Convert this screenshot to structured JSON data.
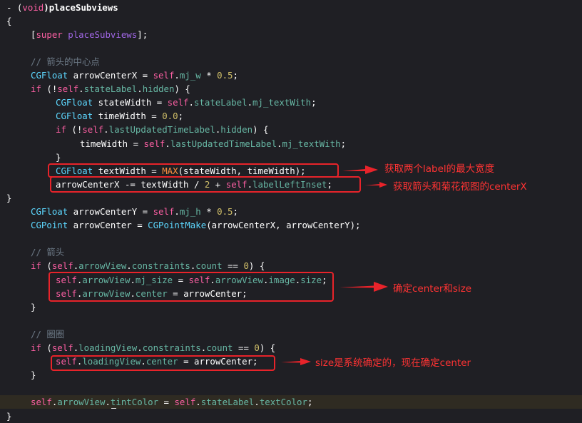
{
  "code_lines": [
    {
      "indent": 0,
      "tokens": [
        {
          "t": "- (",
          "c": "pl"
        },
        {
          "t": "void",
          "c": "kw"
        },
        {
          "t": ")placeSubviews",
          "c": "pl bold"
        }
      ]
    },
    {
      "indent": 0,
      "tokens": [
        {
          "t": "{",
          "c": "pl"
        }
      ]
    },
    {
      "indent": 1,
      "tokens": [
        {
          "t": "[",
          "c": "pl"
        },
        {
          "t": "super",
          "c": "kw"
        },
        {
          "t": " ",
          "c": "pl"
        },
        {
          "t": "placeSubviews",
          "c": "func"
        },
        {
          "t": "];",
          "c": "pl"
        }
      ]
    },
    {
      "indent": 0,
      "tokens": []
    },
    {
      "indent": 1,
      "tokens": [
        {
          "t": "// 箭头的中心点",
          "c": "cmt"
        }
      ]
    },
    {
      "indent": 1,
      "tokens": [
        {
          "t": "CGFloat",
          "c": "cls"
        },
        {
          "t": " arrowCenterX = ",
          "c": "pl"
        },
        {
          "t": "self",
          "c": "kw"
        },
        {
          "t": ".",
          "c": "pl"
        },
        {
          "t": "mj_w",
          "c": "prop"
        },
        {
          "t": " * ",
          "c": "pl"
        },
        {
          "t": "0.5",
          "c": "num"
        },
        {
          "t": ";",
          "c": "pl"
        }
      ]
    },
    {
      "indent": 1,
      "tokens": [
        {
          "t": "if",
          "c": "kw"
        },
        {
          "t": " (!",
          "c": "pl"
        },
        {
          "t": "self",
          "c": "kw"
        },
        {
          "t": ".",
          "c": "pl"
        },
        {
          "t": "stateLabel",
          "c": "prop"
        },
        {
          "t": ".",
          "c": "pl"
        },
        {
          "t": "hidden",
          "c": "prop"
        },
        {
          "t": ") {",
          "c": "pl"
        }
      ]
    },
    {
      "indent": 2,
      "tokens": [
        {
          "t": "CGFloat",
          "c": "cls"
        },
        {
          "t": " stateWidth = ",
          "c": "pl"
        },
        {
          "t": "self",
          "c": "kw"
        },
        {
          "t": ".",
          "c": "pl"
        },
        {
          "t": "stateLabel",
          "c": "prop"
        },
        {
          "t": ".",
          "c": "pl"
        },
        {
          "t": "mj_textWith",
          "c": "prop"
        },
        {
          "t": ";",
          "c": "pl"
        }
      ]
    },
    {
      "indent": 2,
      "tokens": [
        {
          "t": "CGFloat",
          "c": "cls"
        },
        {
          "t": " timeWidth = ",
          "c": "pl"
        },
        {
          "t": "0.0",
          "c": "num"
        },
        {
          "t": ";",
          "c": "pl"
        }
      ]
    },
    {
      "indent": 2,
      "tokens": [
        {
          "t": "if",
          "c": "kw"
        },
        {
          "t": " (!",
          "c": "pl"
        },
        {
          "t": "self",
          "c": "kw"
        },
        {
          "t": ".",
          "c": "pl"
        },
        {
          "t": "lastUpdatedTimeLabel",
          "c": "prop"
        },
        {
          "t": ".",
          "c": "pl"
        },
        {
          "t": "hidden",
          "c": "prop"
        },
        {
          "t": ") {",
          "c": "pl"
        }
      ]
    },
    {
      "indent": 3,
      "tokens": [
        {
          "t": "timeWidth = ",
          "c": "pl"
        },
        {
          "t": "self",
          "c": "kw"
        },
        {
          "t": ".",
          "c": "pl"
        },
        {
          "t": "lastUpdatedTimeLabel",
          "c": "prop"
        },
        {
          "t": ".",
          "c": "pl"
        },
        {
          "t": "mj_textWith",
          "c": "prop"
        },
        {
          "t": ";",
          "c": "pl"
        }
      ]
    },
    {
      "indent": 2,
      "tokens": [
        {
          "t": "}",
          "c": "pl"
        }
      ]
    },
    {
      "indent": 2,
      "tokens": [
        {
          "t": "CGFloat",
          "c": "cls"
        },
        {
          "t": " textWidth = ",
          "c": "pl"
        },
        {
          "t": "MAX",
          "c": "mac"
        },
        {
          "t": "(stateWidth, timeWidth);",
          "c": "pl"
        }
      ]
    },
    {
      "indent": 2,
      "tokens": [
        {
          "t": "arrowCenterX -= textWidth / ",
          "c": "pl"
        },
        {
          "t": "2",
          "c": "num"
        },
        {
          "t": " + ",
          "c": "pl"
        },
        {
          "t": "self",
          "c": "kw"
        },
        {
          "t": ".",
          "c": "pl"
        },
        {
          "t": "labelLeftInset",
          "c": "prop"
        },
        {
          "t": ";",
          "c": "pl"
        }
      ]
    },
    {
      "indent": 0,
      "tokens": [
        {
          "t": "}",
          "c": "pl"
        }
      ]
    },
    {
      "indent": 1,
      "tokens": [
        {
          "t": "CGFloat",
          "c": "cls"
        },
        {
          "t": " arrowCenterY = ",
          "c": "pl"
        },
        {
          "t": "self",
          "c": "kw"
        },
        {
          "t": ".",
          "c": "pl"
        },
        {
          "t": "mj_h",
          "c": "prop"
        },
        {
          "t": " * ",
          "c": "pl"
        },
        {
          "t": "0.5",
          "c": "num"
        },
        {
          "t": ";",
          "c": "pl"
        }
      ]
    },
    {
      "indent": 1,
      "tokens": [
        {
          "t": "CGPoint",
          "c": "cls"
        },
        {
          "t": " arrowCenter = ",
          "c": "pl"
        },
        {
          "t": "CGPointMake",
          "c": "cls"
        },
        {
          "t": "(arrowCenterX, arrowCenterY);",
          "c": "pl"
        }
      ]
    },
    {
      "indent": 0,
      "tokens": []
    },
    {
      "indent": 1,
      "tokens": [
        {
          "t": "// 箭头",
          "c": "cmt"
        }
      ]
    },
    {
      "indent": 1,
      "tokens": [
        {
          "t": "if",
          "c": "kw"
        },
        {
          "t": " (",
          "c": "pl"
        },
        {
          "t": "self",
          "c": "kw"
        },
        {
          "t": ".",
          "c": "pl"
        },
        {
          "t": "arrowView",
          "c": "prop"
        },
        {
          "t": ".",
          "c": "pl"
        },
        {
          "t": "constraints",
          "c": "prop"
        },
        {
          "t": ".",
          "c": "pl"
        },
        {
          "t": "count",
          "c": "prop"
        },
        {
          "t": " == ",
          "c": "pl"
        },
        {
          "t": "0",
          "c": "num"
        },
        {
          "t": ") {",
          "c": "pl"
        }
      ]
    },
    {
      "indent": 2,
      "tokens": [
        {
          "t": "self",
          "c": "kw"
        },
        {
          "t": ".",
          "c": "pl"
        },
        {
          "t": "arrowView",
          "c": "prop"
        },
        {
          "t": ".",
          "c": "pl"
        },
        {
          "t": "mj_size",
          "c": "prop"
        },
        {
          "t": " = ",
          "c": "pl"
        },
        {
          "t": "self",
          "c": "kw"
        },
        {
          "t": ".",
          "c": "pl"
        },
        {
          "t": "arrowView",
          "c": "prop"
        },
        {
          "t": ".",
          "c": "pl"
        },
        {
          "t": "image",
          "c": "prop"
        },
        {
          "t": ".",
          "c": "pl"
        },
        {
          "t": "size",
          "c": "prop"
        },
        {
          "t": ";",
          "c": "pl"
        }
      ]
    },
    {
      "indent": 2,
      "tokens": [
        {
          "t": "self",
          "c": "kw"
        },
        {
          "t": ".",
          "c": "pl"
        },
        {
          "t": "arrowView",
          "c": "prop"
        },
        {
          "t": ".",
          "c": "pl"
        },
        {
          "t": "center",
          "c": "prop"
        },
        {
          "t": " = arrowCenter;",
          "c": "pl"
        }
      ]
    },
    {
      "indent": 1,
      "tokens": [
        {
          "t": "}",
          "c": "pl"
        }
      ]
    },
    {
      "indent": 0,
      "tokens": []
    },
    {
      "indent": 1,
      "tokens": [
        {
          "t": "// 圈圈",
          "c": "cmt"
        }
      ]
    },
    {
      "indent": 1,
      "tokens": [
        {
          "t": "if",
          "c": "kw"
        },
        {
          "t": " (",
          "c": "pl"
        },
        {
          "t": "self",
          "c": "kw"
        },
        {
          "t": ".",
          "c": "pl"
        },
        {
          "t": "loadingView",
          "c": "prop"
        },
        {
          "t": ".",
          "c": "pl"
        },
        {
          "t": "constraints",
          "c": "prop"
        },
        {
          "t": ".",
          "c": "pl"
        },
        {
          "t": "count",
          "c": "prop"
        },
        {
          "t": " == ",
          "c": "pl"
        },
        {
          "t": "0",
          "c": "num"
        },
        {
          "t": ") {",
          "c": "pl"
        }
      ]
    },
    {
      "indent": 2,
      "tokens": [
        {
          "t": "self",
          "c": "kw"
        },
        {
          "t": ".",
          "c": "pl"
        },
        {
          "t": "loadingView",
          "c": "prop"
        },
        {
          "t": ".",
          "c": "pl"
        },
        {
          "t": "center",
          "c": "prop"
        },
        {
          "t": " = arrowCenter;",
          "c": "pl"
        }
      ]
    },
    {
      "indent": 1,
      "tokens": [
        {
          "t": "}",
          "c": "pl"
        }
      ]
    },
    {
      "indent": 0,
      "tokens": []
    },
    {
      "indent": 1,
      "highlighted": true,
      "tokens": [
        {
          "t": "self",
          "c": "kw"
        },
        {
          "t": ".",
          "c": "pl"
        },
        {
          "t": "arrowView",
          "c": "prop"
        },
        {
          "t": ".",
          "c": "pl"
        },
        {
          "t": "tintColor",
          "c": "prop"
        },
        {
          "t": " = ",
          "c": "pl"
        },
        {
          "t": "self",
          "c": "kw"
        },
        {
          "t": ".",
          "c": "pl"
        },
        {
          "t": "stateLabel",
          "c": "prop"
        },
        {
          "t": ".",
          "c": "pl"
        },
        {
          "t": "textColor",
          "c": "prop"
        },
        {
          "t": ";",
          "c": "pl"
        }
      ]
    },
    {
      "indent": 0,
      "tokens": [
        {
          "t": "}",
          "c": "pl"
        }
      ]
    }
  ],
  "annotations": {
    "max_label_width": "获取两个label的最大宽度",
    "arrow_center_x": "获取箭头和菊花视图的centerX",
    "center_and_size": "确定center和size",
    "size_then_center": "size是系统确定的，现在确定center"
  },
  "colors": {
    "background": "#1f1f24",
    "current_line": "#2f2b22",
    "keyword": "#fc5fa3",
    "class_name": "#5dd8ff",
    "property": "#67b7a4",
    "number": "#d0bf69",
    "comment": "#6c7986",
    "macro": "#fd8f3f",
    "annotation_red": "#e8232a"
  }
}
